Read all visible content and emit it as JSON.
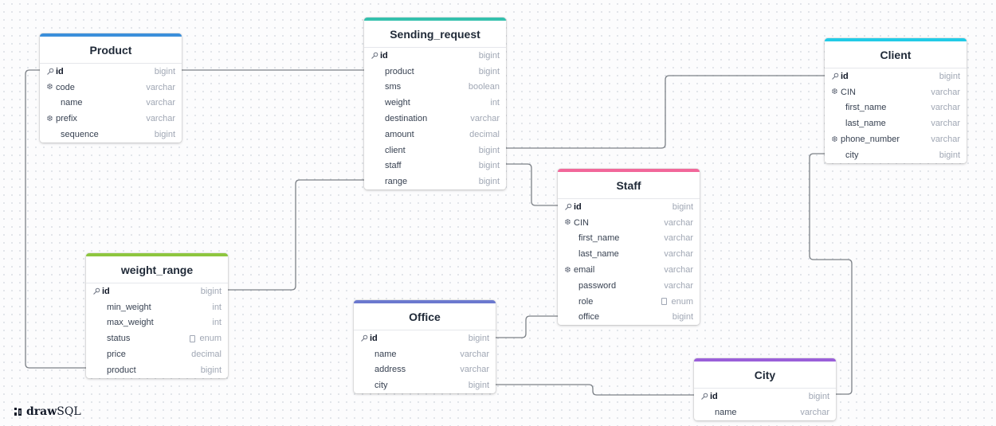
{
  "brand": {
    "logo_bold": "draw",
    "logo_rest": "SQL",
    "logo_name": "drawsql-logo"
  },
  "tables": [
    {
      "name": "Product",
      "color": "#3b8fdb",
      "columns": [
        {
          "name": "id",
          "type": "bigint",
          "key": "pk"
        },
        {
          "name": "code",
          "type": "varchar",
          "key": "unique"
        },
        {
          "name": "name",
          "type": "varchar"
        },
        {
          "name": "prefix",
          "type": "varchar",
          "key": "unique"
        },
        {
          "name": "sequence",
          "type": "bigint"
        }
      ]
    },
    {
      "name": "Sending_request",
      "color": "#34c0ad",
      "columns": [
        {
          "name": "id",
          "type": "bigint",
          "key": "pk"
        },
        {
          "name": "product",
          "type": "bigint"
        },
        {
          "name": "sms",
          "type": "boolean"
        },
        {
          "name": "weight",
          "type": "int"
        },
        {
          "name": "destination",
          "type": "varchar"
        },
        {
          "name": "amount",
          "type": "decimal"
        },
        {
          "name": "client",
          "type": "bigint"
        },
        {
          "name": "staff",
          "type": "bigint"
        },
        {
          "name": "range",
          "type": "bigint"
        }
      ]
    },
    {
      "name": "Client",
      "color": "#22cbe6",
      "columns": [
        {
          "name": "id",
          "type": "bigint",
          "key": "pk"
        },
        {
          "name": "CIN",
          "type": "varchar",
          "key": "unique"
        },
        {
          "name": "first_name",
          "type": "varchar"
        },
        {
          "name": "last_name",
          "type": "varchar"
        },
        {
          "name": "phone_number",
          "type": "varchar",
          "key": "unique"
        },
        {
          "name": "city",
          "type": "bigint"
        }
      ]
    },
    {
      "name": "Staff",
      "color": "#f2679a",
      "columns": [
        {
          "name": "id",
          "type": "bigint",
          "key": "pk"
        },
        {
          "name": "CIN",
          "type": "varchar",
          "key": "unique"
        },
        {
          "name": "first_name",
          "type": "varchar"
        },
        {
          "name": "last_name",
          "type": "varchar"
        },
        {
          "name": "email",
          "type": "varchar",
          "key": "unique"
        },
        {
          "name": "password",
          "type": "varchar"
        },
        {
          "name": "role",
          "type": "enum",
          "enum": true
        },
        {
          "name": "office",
          "type": "bigint"
        }
      ]
    },
    {
      "name": "weight_range",
      "color": "#8ec63f",
      "columns": [
        {
          "name": "id",
          "type": "bigint",
          "key": "pk"
        },
        {
          "name": "min_weight",
          "type": "int"
        },
        {
          "name": "max_weight",
          "type": "int"
        },
        {
          "name": "status",
          "type": "enum",
          "enum": true
        },
        {
          "name": "price",
          "type": "decimal"
        },
        {
          "name": "product",
          "type": "bigint"
        }
      ]
    },
    {
      "name": "Office",
      "color": "#6b79cf",
      "columns": [
        {
          "name": "id",
          "type": "bigint",
          "key": "pk"
        },
        {
          "name": "name",
          "type": "varchar"
        },
        {
          "name": "address",
          "type": "varchar"
        },
        {
          "name": "city",
          "type": "bigint"
        }
      ]
    },
    {
      "name": "City",
      "color": "#9a5fd9",
      "columns": [
        {
          "name": "id",
          "type": "bigint",
          "key": "pk"
        },
        {
          "name": "name",
          "type": "varchar"
        }
      ]
    }
  ],
  "relationships": [
    {
      "from": "Sending_request.product",
      "to": "Product.id"
    },
    {
      "from": "Sending_request.client",
      "to": "Client.id"
    },
    {
      "from": "Sending_request.staff",
      "to": "Staff.id"
    },
    {
      "from": "Sending_request.range",
      "to": "weight_range.id"
    },
    {
      "from": "weight_range.product",
      "to": "Product.id"
    },
    {
      "from": "Staff.office",
      "to": "Office.id"
    },
    {
      "from": "Office.city",
      "to": "City.id"
    },
    {
      "from": "Client.city",
      "to": "City.id"
    }
  ]
}
